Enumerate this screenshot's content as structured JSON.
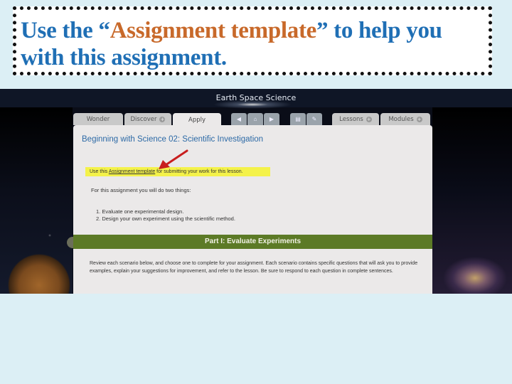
{
  "slide": {
    "title_part1": "Use the “",
    "title_highlight": "Assignment template",
    "title_part2": "” to help you with this assignment.",
    "colors": {
      "background": "#dceff5",
      "title_blue": "#1f6fb5",
      "title_orange": "#c8692a"
    }
  },
  "screenshot": {
    "app_title": "Earth Space Science",
    "tabs": [
      {
        "label": "Wonder",
        "has_dropdown": false,
        "active": false
      },
      {
        "label": "Discover",
        "has_dropdown": true,
        "active": false
      },
      {
        "label": "Apply",
        "has_dropdown": false,
        "active": true
      }
    ],
    "nav_buttons": [
      {
        "icon": "back-arrow-icon",
        "glyph": "◀"
      },
      {
        "icon": "home-icon",
        "glyph": "⌂"
      },
      {
        "icon": "forward-arrow-icon",
        "glyph": "▶"
      }
    ],
    "tool_buttons": [
      {
        "icon": "notes-icon",
        "glyph": "▤"
      },
      {
        "icon": "edit-icon",
        "glyph": "✎"
      }
    ],
    "right_tabs": [
      {
        "label": "Lessons",
        "has_dropdown": true
      },
      {
        "label": "Modules",
        "has_dropdown": true
      }
    ],
    "lesson_title": "Beginning with Science 02: Scientific Investigation",
    "instruction": {
      "prefix": "Use this ",
      "link": "Assignment template",
      "suffix": " for submitting your work for this lesson."
    },
    "intro": "For this assignment you will do two things:",
    "tasks": [
      "1.  Evaluate one experimental design.",
      "2.  Design your own experiment using the scientific method."
    ],
    "part_heading": "Part I: Evaluate Experiments",
    "part_text": "Review each scenario below, and choose one to complete for your assignment. Each scenario contains specific questions that will ask you to provide examples, explain your suggestions for improvement, and refer to the lesson. Be sure to respond to each question in complete sentences.",
    "colors": {
      "part_bar": "#5c7a26",
      "highlight": "#f4f24a",
      "lesson_title": "#2d6aa6",
      "arrow": "#c81e1e"
    }
  }
}
